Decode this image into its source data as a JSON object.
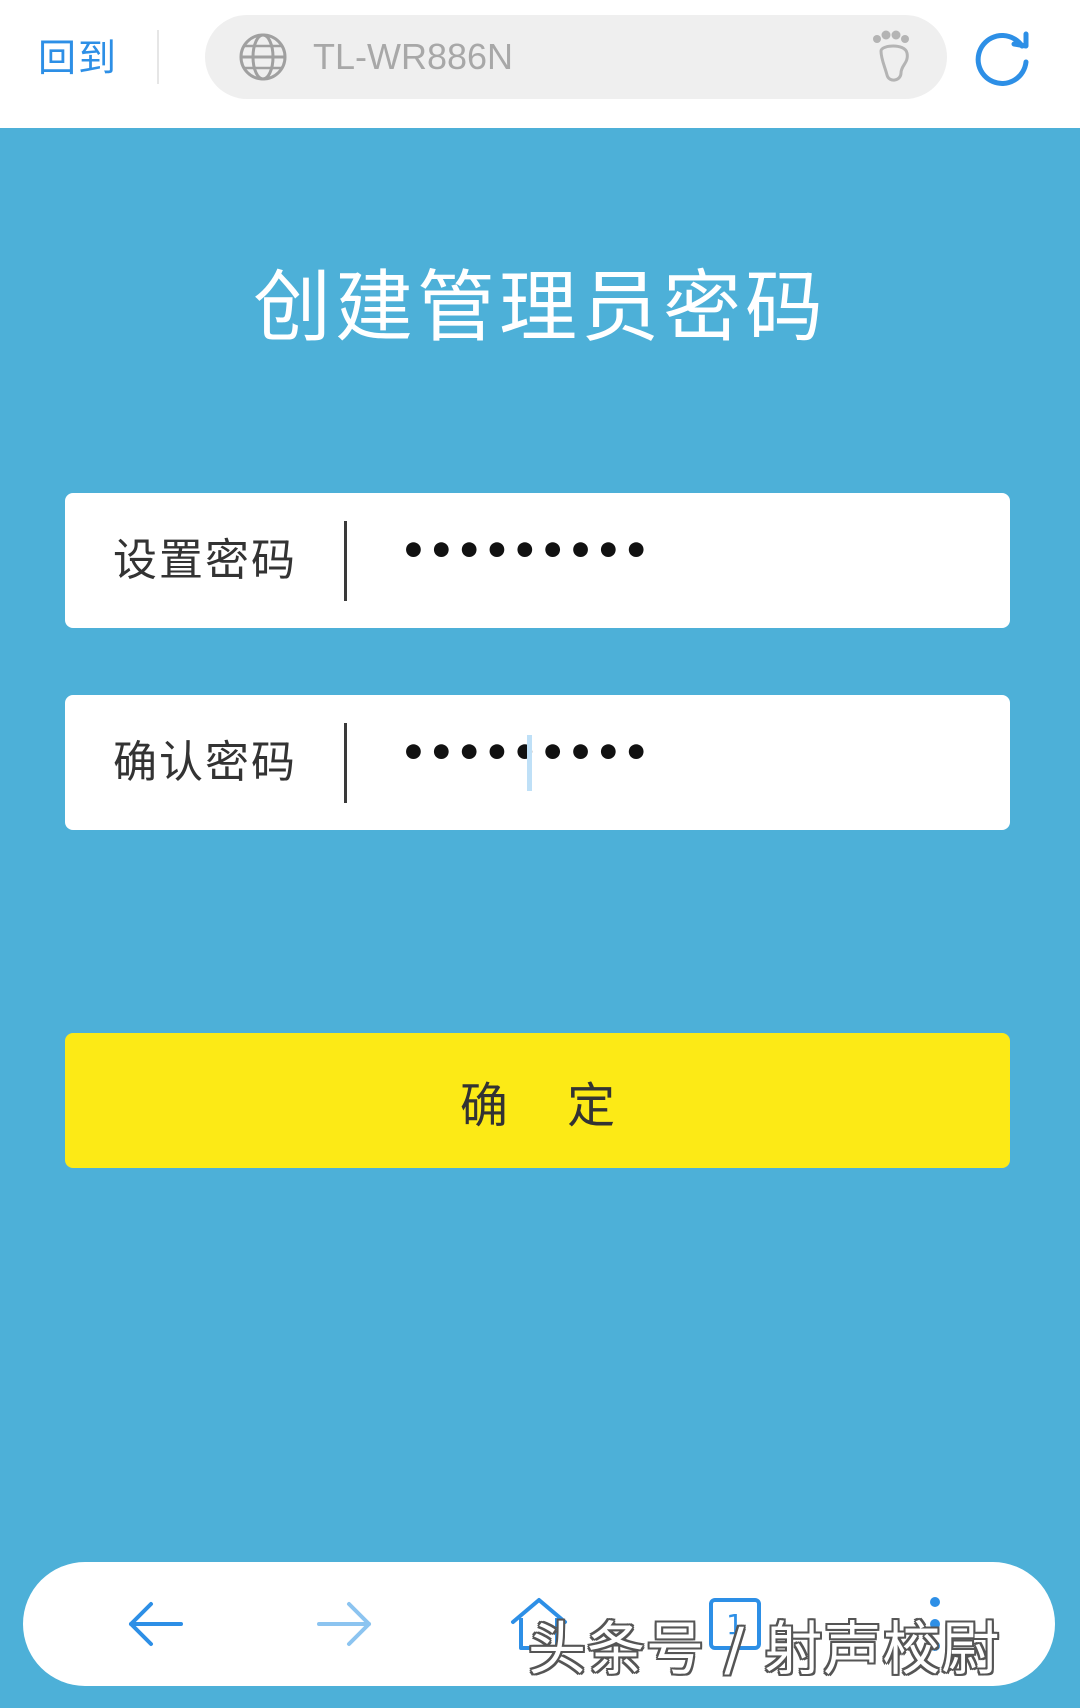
{
  "browser": {
    "back_label": "回到",
    "url": "TL-WR886N"
  },
  "page": {
    "title": "创建管理员密码"
  },
  "fields": [
    {
      "label": "设置密码",
      "value": "•••••••••"
    },
    {
      "label": "确认密码",
      "value": "•••••••••"
    }
  ],
  "confirm_button": {
    "label": "确 定"
  },
  "bottom_nav": {
    "tab_count": "1"
  },
  "watermark": "头条号 / 射声校尉",
  "colors": {
    "background": "#4db0d8",
    "accent": "#2d8fe6",
    "button": "#fcea16"
  }
}
